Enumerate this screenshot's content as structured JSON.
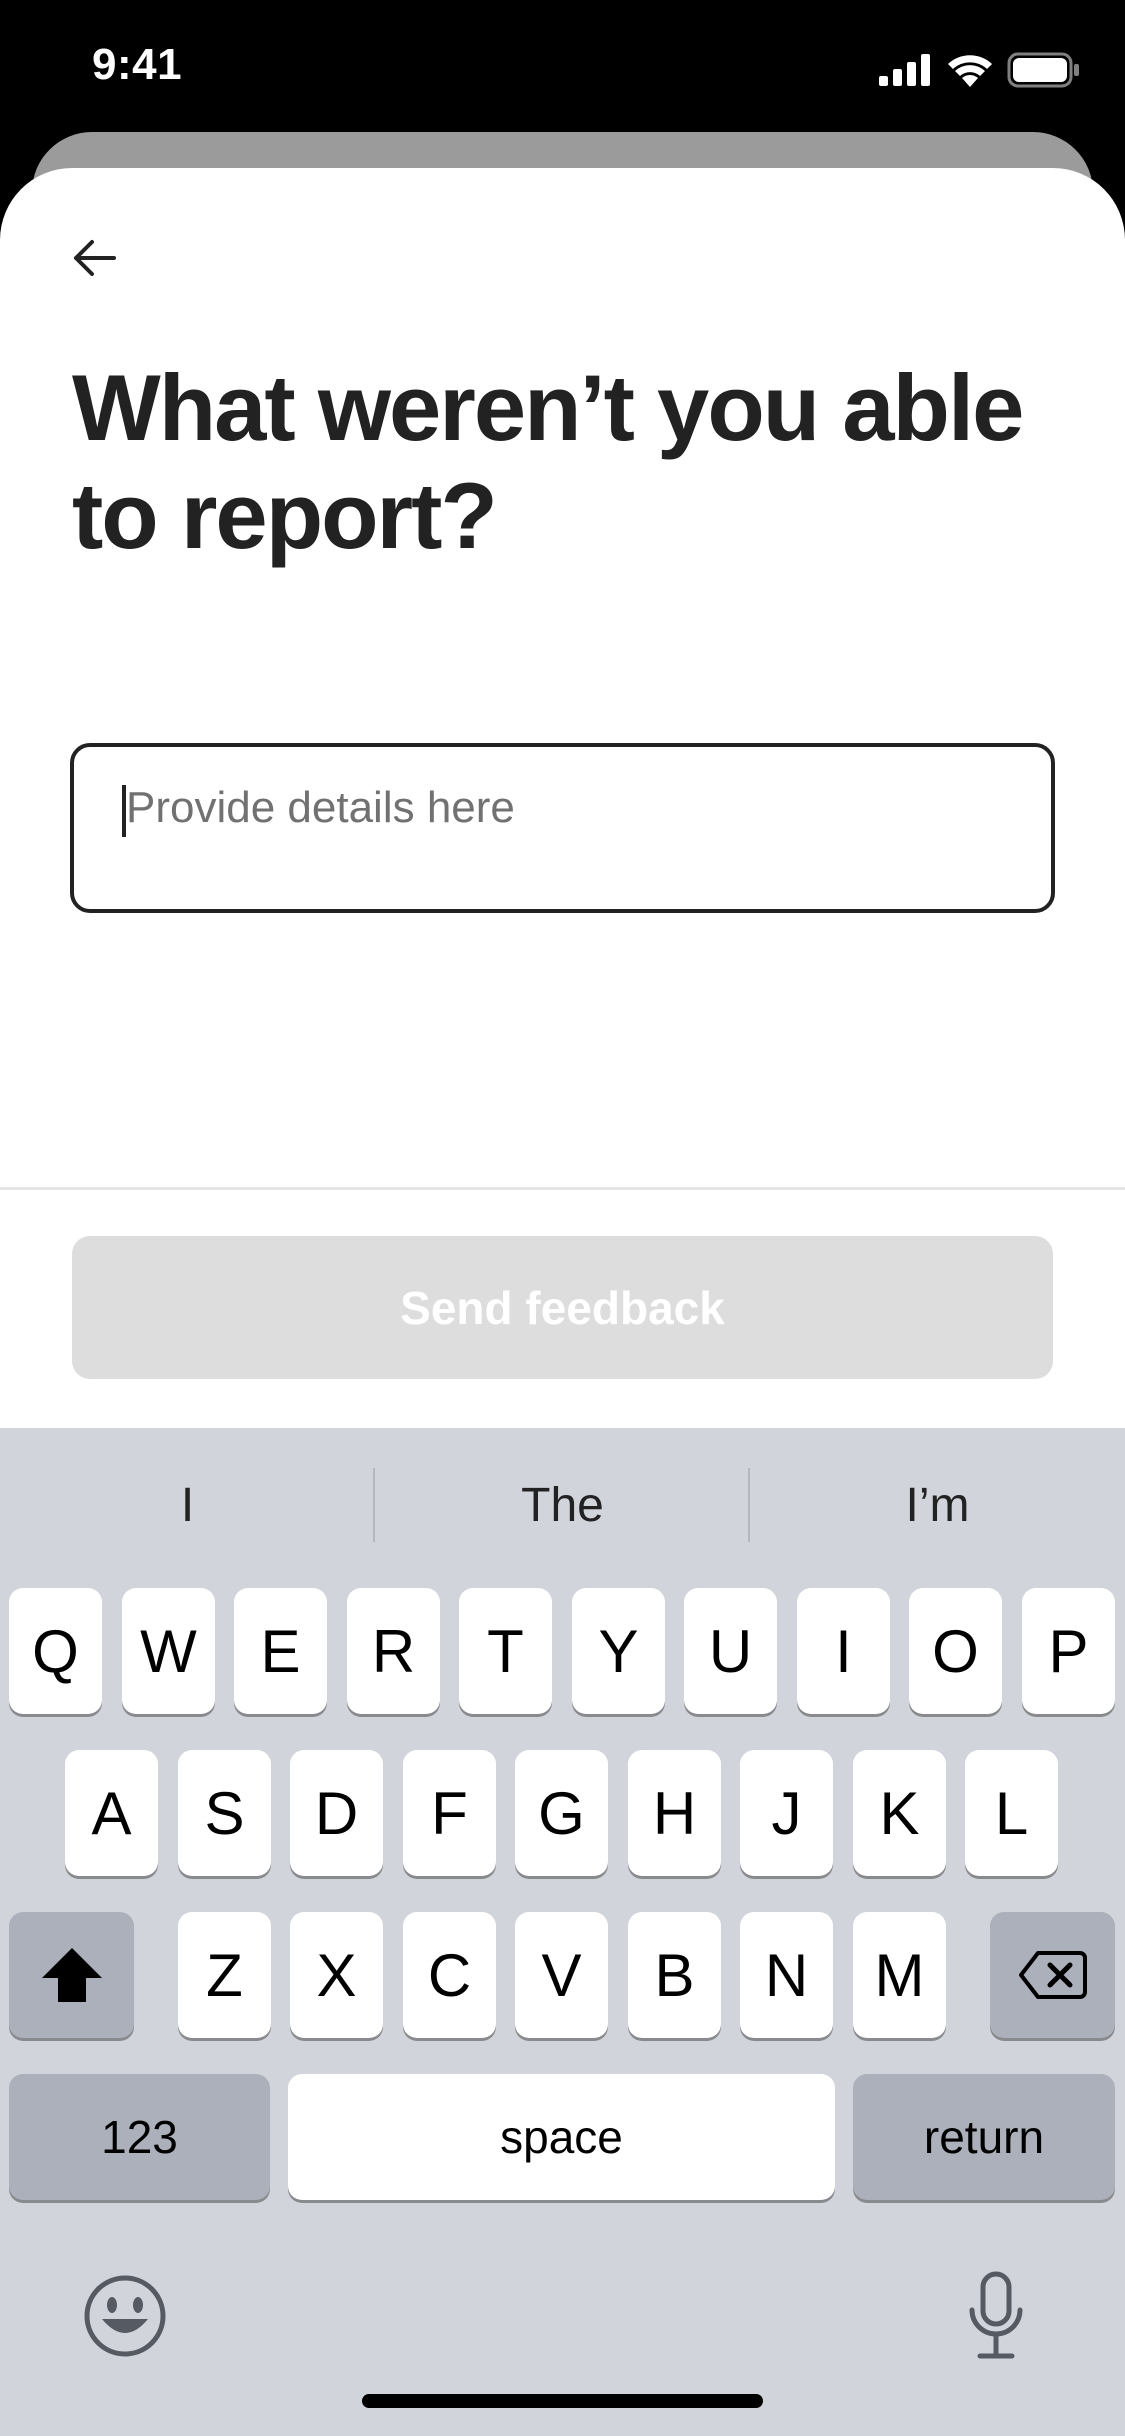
{
  "status_bar": {
    "time": "9:41",
    "icons": [
      "signal-icon",
      "wifi-icon",
      "battery-icon"
    ]
  },
  "header": {
    "back_icon": "arrow-left-icon"
  },
  "main": {
    "title": "What weren’t you able to report?",
    "input": {
      "value": "",
      "placeholder": "Provide details here"
    },
    "send_button_label": "Send feedback"
  },
  "keyboard": {
    "suggestions": [
      "I",
      "The",
      "I’m"
    ],
    "row1": [
      "Q",
      "W",
      "E",
      "R",
      "T",
      "Y",
      "U",
      "I",
      "O",
      "P"
    ],
    "row2": [
      "A",
      "S",
      "D",
      "F",
      "G",
      "H",
      "J",
      "K",
      "L"
    ],
    "row3": [
      "Z",
      "X",
      "C",
      "V",
      "B",
      "N",
      "M"
    ],
    "numbers_label": "123",
    "space_label": "space",
    "return_label": "return",
    "shift_icon": "shift-icon",
    "delete_icon": "backspace-icon",
    "emoji_icon": "emoji-icon",
    "mic_icon": "microphone-icon"
  },
  "colors": {
    "text_primary": "#222222",
    "placeholder": "#717171",
    "button_disabled_bg": "#dddddd",
    "keyboard_bg": "#d1d4db",
    "key_dark": "#abb0ba"
  }
}
